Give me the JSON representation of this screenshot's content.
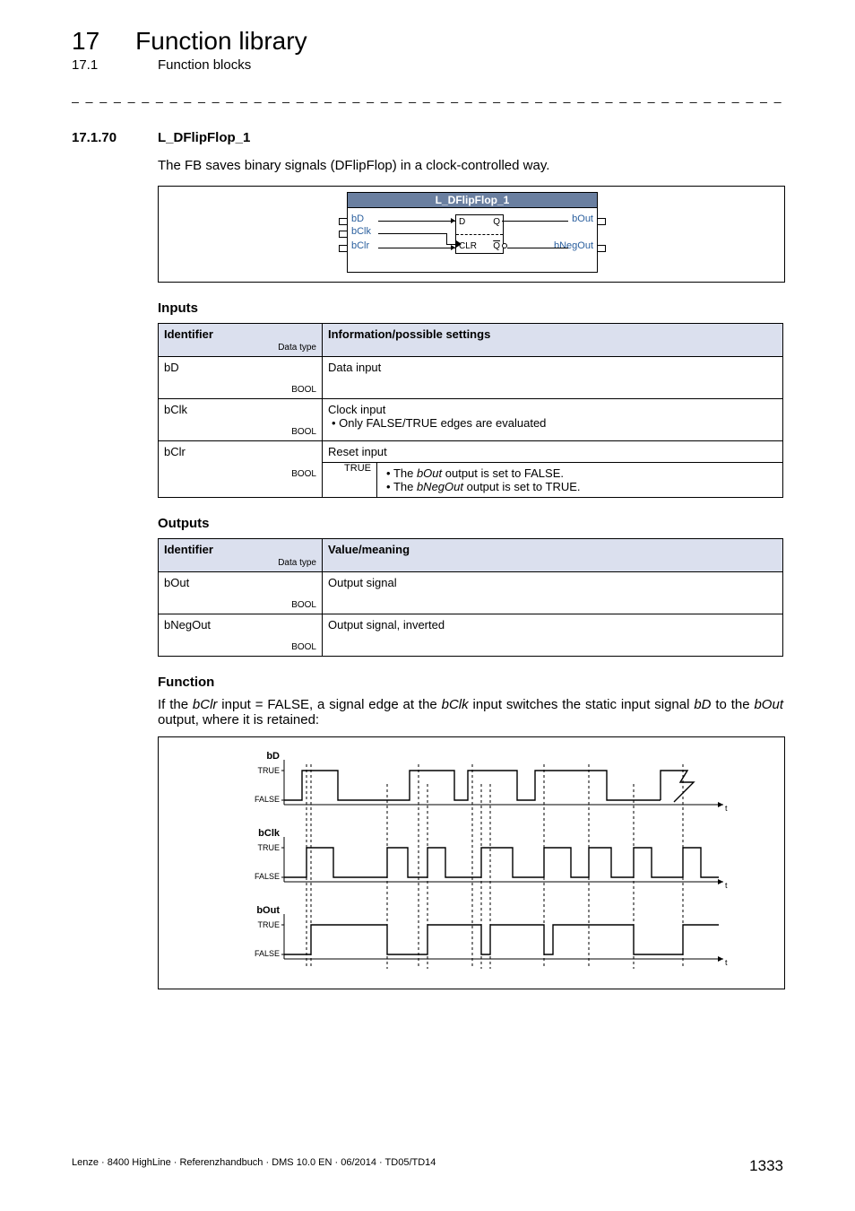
{
  "chapter": {
    "num": "17",
    "title": "Function library"
  },
  "section": {
    "num": "17.1",
    "title": "Function blocks"
  },
  "subsection": {
    "num": "17.1.70",
    "title": "L_DFlipFlop_1"
  },
  "lead": "The FB saves binary signals (DFlipFlop) in a clock-controlled way.",
  "fb": {
    "title": "L_DFlipFlop_1",
    "in": [
      "bD",
      "bClk",
      "bClr"
    ],
    "out": [
      "bOut",
      "bNegOut"
    ],
    "inner": {
      "d": "D",
      "q": "Q",
      "clr": "CLR",
      "qbar": "Q"
    }
  },
  "headings": {
    "inputs": "Inputs",
    "outputs": "Outputs",
    "function": "Function",
    "identifier": "Identifier",
    "datatype": "Data type",
    "info": "Information/possible settings",
    "value": "Value/meaning"
  },
  "inputs": [
    {
      "id": "bD",
      "type": "BOOL",
      "desc": "Data input"
    },
    {
      "id": "bClk",
      "type": "BOOL",
      "desc": "Clock input",
      "bullets": [
        "Only FALSE/TRUE edges are evaluated"
      ]
    },
    {
      "id": "bClr",
      "type": "BOOL",
      "desc": "Reset input",
      "true_label": "TRUE",
      "true_bullets": [
        "The <i>bOut</i> output is set to FALSE.",
        "The <i>bNegOut</i> output is set to TRUE."
      ]
    }
  ],
  "outputs": [
    {
      "id": "bOut",
      "type": "BOOL",
      "desc": "Output signal"
    },
    {
      "id": "bNegOut",
      "type": "BOOL",
      "desc": "Output signal, inverted"
    }
  ],
  "function_text_pre": "If the ",
  "function_text_sig1": "bClr",
  "function_text_mid1": " input = FALSE, a signal edge at the ",
  "function_text_sig2": "bClk",
  "function_text_mid2": " input switches the static input signal ",
  "function_text_sig3": "bD",
  "function_text_mid3": " to the ",
  "function_text_sig4": "bOut",
  "function_text_end": " output, where it is retained:",
  "timing": {
    "signals": [
      "bD",
      "bClk",
      "bOut"
    ],
    "levels": [
      "TRUE",
      "FALSE"
    ],
    "axis": "t"
  },
  "footer": {
    "left": "Lenze · 8400 HighLine · Referenzhandbuch · DMS 10.0 EN · 06/2014 · TD05/TD14",
    "page": "1333"
  }
}
